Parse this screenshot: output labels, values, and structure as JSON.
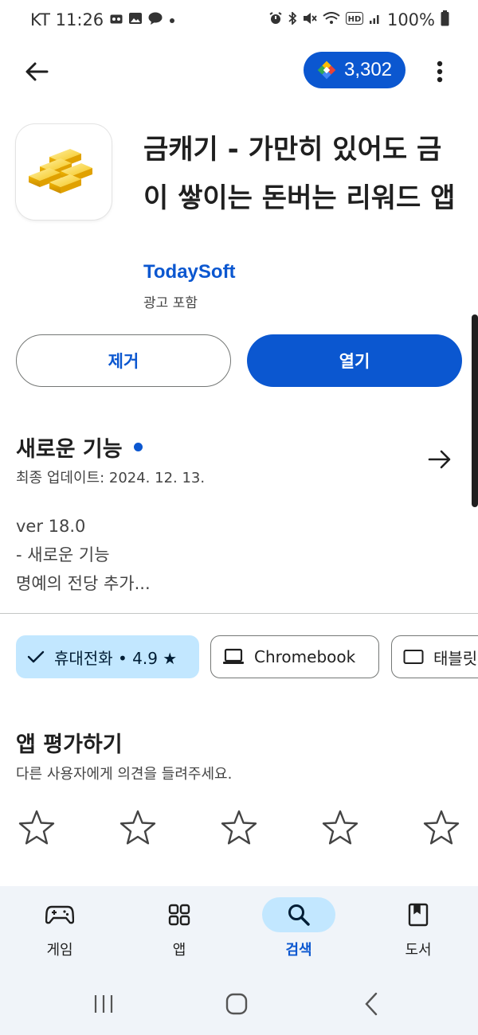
{
  "status_bar": {
    "carrier_time": "KT 11:26",
    "battery": "100%",
    "left_icons": [
      "voicemail-icon",
      "gallery-icon",
      "messenger-icon",
      "dot-icon"
    ],
    "right_icons": [
      "alarm-icon",
      "bluetooth-icon",
      "mute-icon",
      "wifi-icon",
      "hd-icon",
      "signal-icon",
      "battery-icon"
    ]
  },
  "header": {
    "points": "3,302",
    "points_icon": "play-points-diamond-icon"
  },
  "app": {
    "title": "금캐기 - 가만히 있어도 금이 쌓이는 돈버는 리워드 앱",
    "developer": "TodaySoft",
    "ads_note": "광고 포함",
    "icon": "gold-bars-icon"
  },
  "actions": {
    "uninstall_label": "제거",
    "open_label": "열기"
  },
  "whats_new": {
    "title": "새로운 기능",
    "updated": "최종 업데이트: 2024. 12. 13.",
    "notes": [
      "ver 18.0",
      "- 새로운 기능",
      "명예의 전당 추가..."
    ]
  },
  "devices": [
    {
      "label": "휴대전화 • 4.9 ★",
      "icon": "check-icon",
      "selected": true
    },
    {
      "label": "Chromebook",
      "icon": "laptop-icon",
      "selected": false
    },
    {
      "label": "태블릿",
      "icon": "tablet-icon",
      "selected": false
    }
  ],
  "rate": {
    "title": "앱 평가하기",
    "subtitle": "다른 사용자에게 의견을 들려주세요.",
    "stars": 5
  },
  "bottom_nav": [
    {
      "label": "게임",
      "icon": "gamepad-icon",
      "active": false
    },
    {
      "label": "앱",
      "icon": "apps-grid-icon",
      "active": false
    },
    {
      "label": "검색",
      "icon": "search-icon",
      "active": true
    },
    {
      "label": "도서",
      "icon": "book-icon",
      "active": false
    }
  ],
  "colors": {
    "accent": "#0b57d0",
    "chip_selected": "#c2e7ff",
    "nav_background": "#f0f4f9"
  }
}
